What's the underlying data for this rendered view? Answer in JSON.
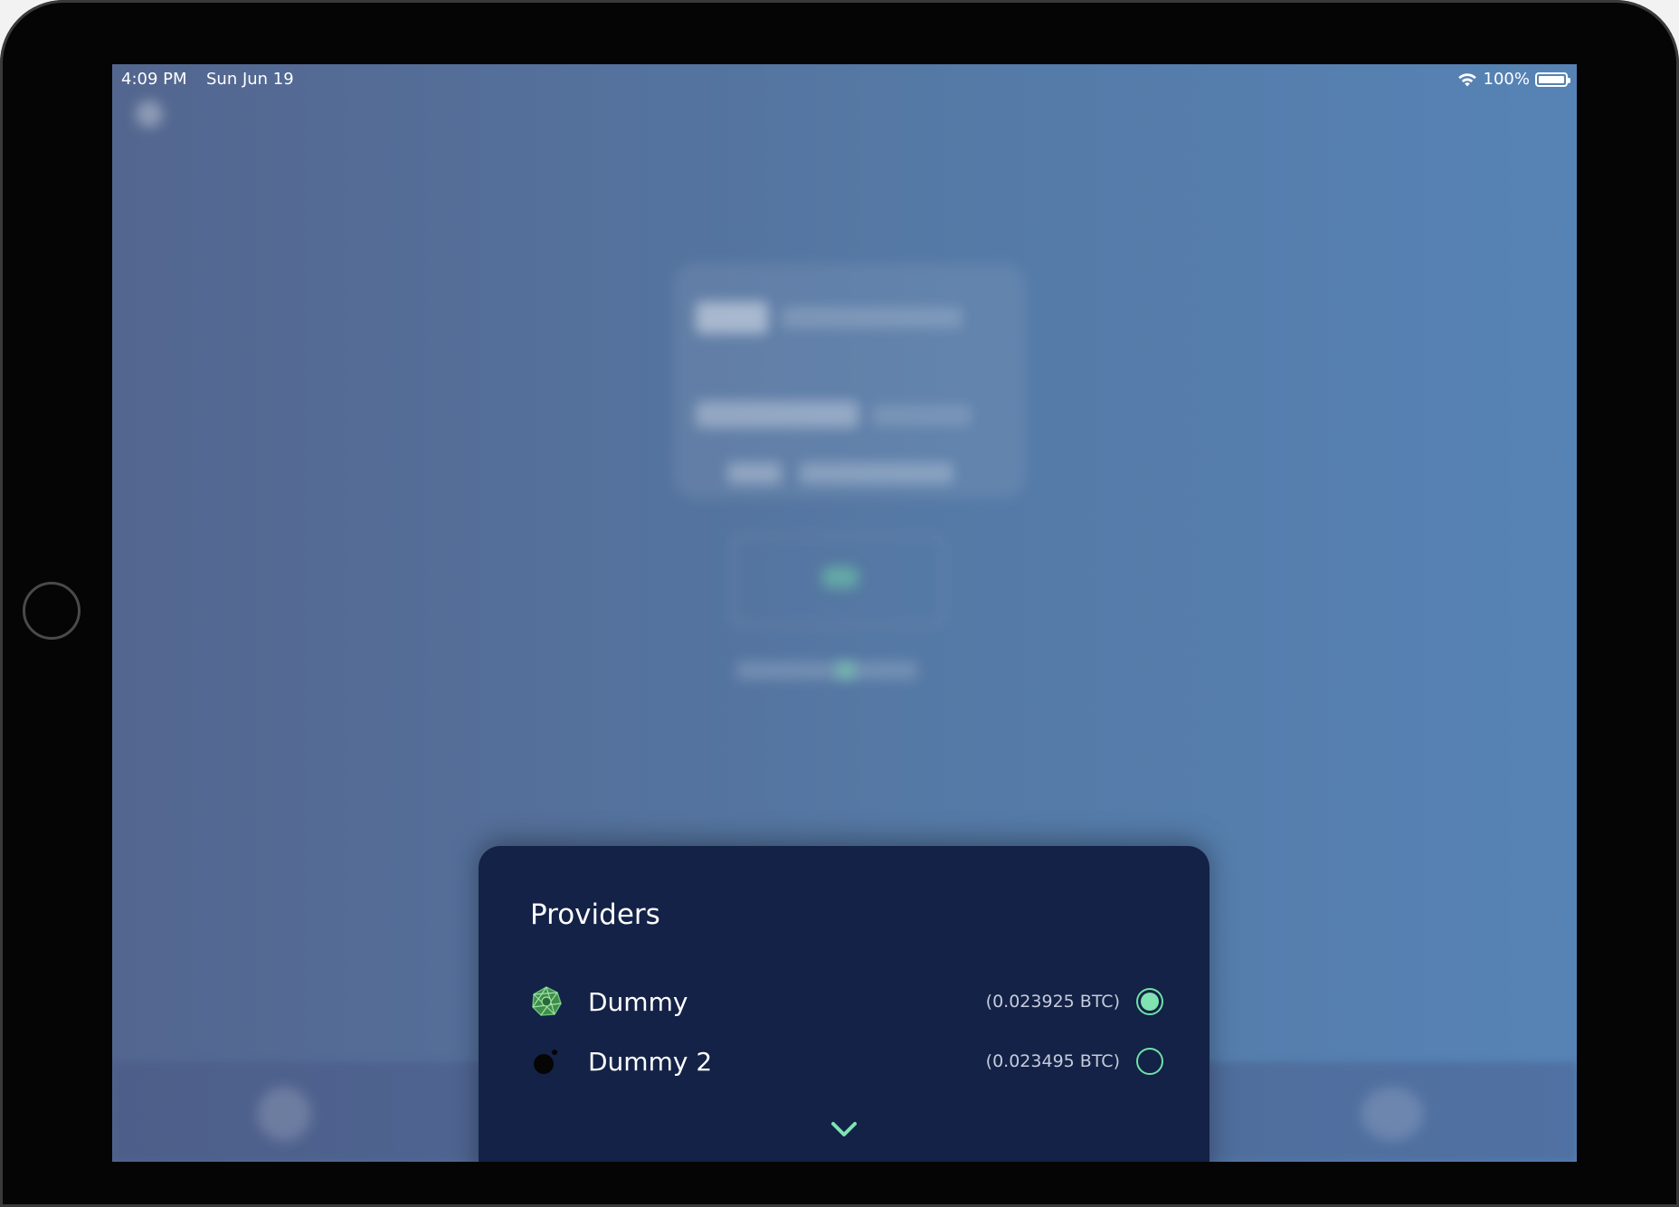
{
  "status_bar": {
    "time": "4:09 PM",
    "date": "Sun Jun 19",
    "battery": "100%",
    "icons": [
      "wifi-icon",
      "battery-icon"
    ]
  },
  "sheet": {
    "title": "Providers",
    "providers": [
      {
        "name": "Dummy",
        "amount": "(0.023925 BTC)",
        "selected": true,
        "icon": "green-network-logo-icon"
      },
      {
        "name": "Dummy 2",
        "amount": "(0.023495 BTC)",
        "selected": false,
        "icon": "black-bomb-logo-icon"
      }
    ],
    "expand_icon": "chevron-down-icon"
  },
  "colors": {
    "sheet_background": "#132246",
    "accent": "#7fe3b2"
  }
}
